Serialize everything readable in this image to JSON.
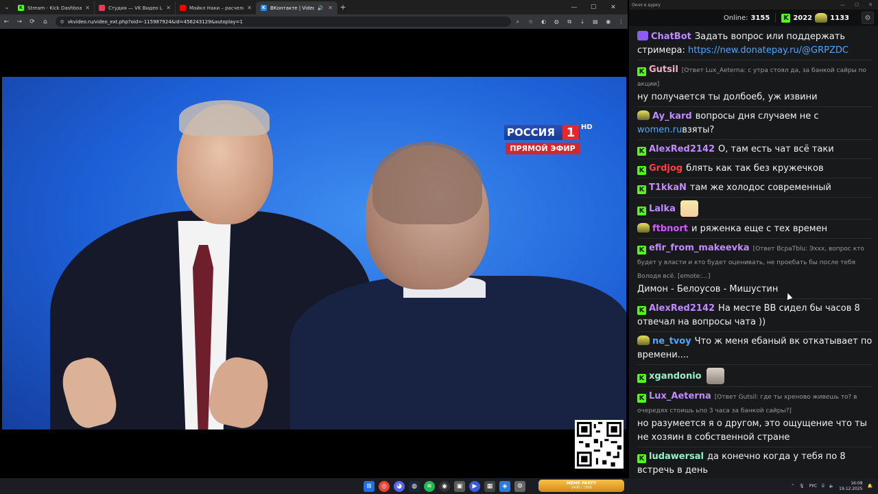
{
  "browser": {
    "tabs": [
      {
        "label": "Stream - Kick Dashboard",
        "color": "#53fc18",
        "glyph": "K"
      },
      {
        "label": "Студия — VK Видео Live",
        "color": "#e53a5a",
        "glyph": ""
      },
      {
        "label": "Майкл Наки – расчеловечива...",
        "color": "#ff0000",
        "glyph": ""
      },
      {
        "label": "ВКонтакте | Video Ext",
        "color": "#2787f5",
        "glyph": "K",
        "active": true
      }
    ],
    "url": "vkvideo.ru/video_ext.php?oid=-115987924&id=456243129&autoplay=1"
  },
  "video": {
    "channel_name": "РОССИЯ",
    "channel_number": "1",
    "channel_hd": "HD",
    "live_label": "ПРЯМОЙ ЭФИР"
  },
  "chat": {
    "window_title": "Окно в дурку",
    "online_label": "Online:",
    "online_count": "3155",
    "kick_count": "2022",
    "sub_count": "1133",
    "messages": [
      {
        "user": "ChatBot",
        "color": "#c08bff",
        "badge": "bot",
        "text": "Задать вопрос или поддержать стримера: ",
        "link": "https://new.donatepay.ru/@GRPZDC"
      },
      {
        "user": "Gutsil",
        "color": "#f4b0c5",
        "badge": "kick",
        "reply": "[Ответ Lux_Aeterna: с утра стоял да, за банкой сайры по акции]",
        "text": "ну получается ты долбоеб, уж извини"
      },
      {
        "user": "Ay_kard",
        "color": "#c08bff",
        "badge": "sub",
        "text": "вопросы дня случаем не с ",
        "link": "women.ru",
        "text2": "взяты?"
      },
      {
        "user": "AlexRed2142",
        "color": "#c08bff",
        "badge": "kick",
        "text": "О, там есть чат всё таки"
      },
      {
        "user": "Grdjog",
        "color": "#ff4040",
        "badge": "kick",
        "text": "блять как так без кружечков"
      },
      {
        "user": "T1kkaN",
        "color": "#c08bff",
        "badge": "kick",
        "text": "там же холодос современный"
      },
      {
        "user": "Lalka",
        "color": "#c08bff",
        "badge": "kick",
        "text": "",
        "emote": "anime"
      },
      {
        "user": "ftbnort",
        "color": "#d35cff",
        "badge": "sub",
        "text": "и ряженка еще с тех времен"
      },
      {
        "user": "efir_from_makeevka",
        "color": "#c08bff",
        "badge": "kick",
        "reply": "[Ответ ВсраТblu: Эххх, вопрос кто будет у власти и кто будет оценивать, не проебать бы после тебя Володя всё. [emote:...]",
        "text": "Димон - Белоусов - Мишустин"
      },
      {
        "user": "AlexRed2142",
        "color": "#c08bff",
        "badge": "kick",
        "text": "На месте ВВ сидел бы часов 8 отвечал на вопросы чата ))"
      },
      {
        "user": "ne_tvoy",
        "color": "#4fa8ff",
        "badge": "sub",
        "text": "Что ж меня ебаный вк откатывает по времени...."
      },
      {
        "user": "xgandonio",
        "color": "#9bf0c8",
        "badge": "kick",
        "text": "",
        "emote": "cat"
      },
      {
        "user": "Lux_Aeterna",
        "color": "#c08bff",
        "badge": "kick",
        "reply": "[Ответ Gutsil: где ты хреново живешь то? в очередях стоишь ьпо 3 часа за банкой сайры?]",
        "text": "но разумеется я о другом, это ощущение что ты не хозяин в собственной стране"
      },
      {
        "user": "ludawersal",
        "color": "#9bf0c8",
        "badge": "kick",
        "text": "да конечно когда у тебя по 8 встречь в день"
      }
    ]
  },
  "taskbar": {
    "widget_title": "MEME PARTY",
    "widget_value": "1400 / 1500",
    "lang": "РУС",
    "time": "16:08",
    "date": "19.12.2025"
  }
}
